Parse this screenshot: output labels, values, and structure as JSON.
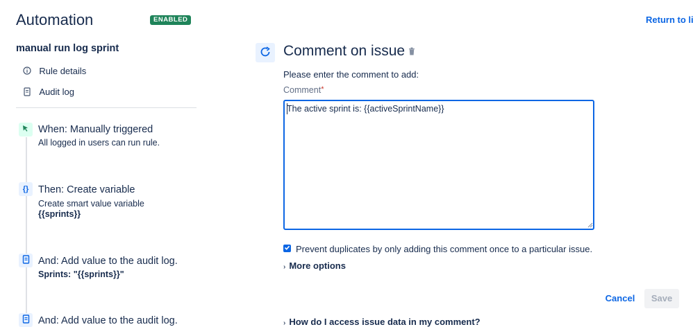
{
  "header": {
    "title": "Automation",
    "status_badge": "ENABLED",
    "return_link": "Return to lis"
  },
  "sidebar": {
    "rule_name": "manual run log sprint",
    "nav": [
      {
        "label": "Rule details",
        "icon": "info-icon"
      },
      {
        "label": "Audit log",
        "icon": "document-icon"
      }
    ],
    "steps": [
      {
        "title": "When: Manually triggered",
        "subtitle": "All logged in users can run rule.",
        "detail": "",
        "icon": "cursor-click-icon"
      },
      {
        "title": "Then: Create variable",
        "subtitle": "Create smart value variable",
        "detail": "{{sprints}}",
        "icon": "curly-braces-icon"
      },
      {
        "title": "And: Add value to the audit log.",
        "subtitle": "",
        "detail": "Sprints: \"{{sprints}}\"",
        "icon": "document-icon"
      },
      {
        "title": "And: Add value to the audit log.",
        "subtitle": "",
        "detail": "",
        "icon": "document-icon"
      }
    ]
  },
  "main": {
    "action_title": "Comment on issue",
    "instruction": "Please enter the comment to add:",
    "comment_label": "Comment",
    "required_mark": "*",
    "comment_value": "The active sprint is: {{activeSprintName}}",
    "prevent_duplicates_label": "Prevent duplicates by only adding this comment once to a particular issue.",
    "prevent_duplicates_checked": true,
    "more_options": "More options",
    "cancel_label": "Cancel",
    "save_label": "Save",
    "help_link": "How do I access issue data in my comment?"
  },
  "colors": {
    "accent": "#0c66e4",
    "enabled_badge": "#1f845a",
    "trigger_icon_bg": "#dcfff1",
    "action_icon_bg": "#e9f2ff"
  }
}
